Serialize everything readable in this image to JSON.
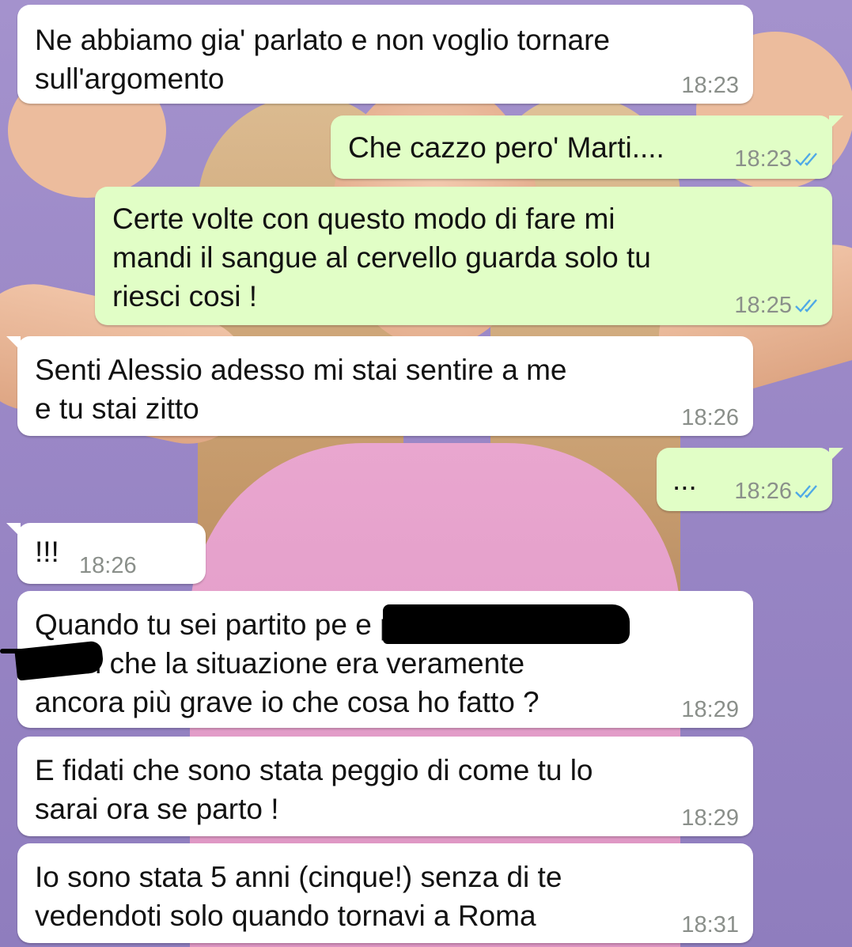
{
  "colors": {
    "incoming_bubble": "#ffffff",
    "outgoing_bubble": "#e1fec6",
    "read_ticks": "#4fa9e6",
    "time": "#8a8f8a"
  },
  "messages": [
    {
      "direction": "in",
      "text": "Ne abbiamo gia' parlato e non voglio tornare\nsull'argomento",
      "time": "18:23"
    },
    {
      "direction": "out",
      "text": "Che cazzo pero' Marti....",
      "time": "18:23",
      "status": "read-ticks-icon"
    },
    {
      "direction": "out",
      "text": "Certe volte con questo modo di fare mi\nmandi il sangue al cervello guarda solo tu\nriesci cosi !",
      "time": "18:25",
      "status": "read-ticks-icon"
    },
    {
      "direction": "in",
      "text": "Senti Alessio adesso mi stai sentire a me\ne tu stai zitto",
      "time": "18:26"
    },
    {
      "direction": "out",
      "text": "...",
      "time": "18:26",
      "status": "read-ticks-icon"
    },
    {
      "direction": "in",
      "text": "!!!",
      "time": "18:26"
    },
    {
      "direction": "in",
      "text": "Quando tu sei partito pe                             e poi\n         e li si che la situazione era veramente\nancora più grave io che cosa ho fatto ?",
      "time": "18:29"
    },
    {
      "direction": "in",
      "text": "E fidati che sono stata peggio di come tu lo\nsarai ora se parto !",
      "time": "18:29"
    },
    {
      "direction": "in",
      "text": "Io sono stata 5 anni (cinque!) senza di te\nvedendoti solo quando tornavi a Roma",
      "time": "18:31"
    }
  ]
}
